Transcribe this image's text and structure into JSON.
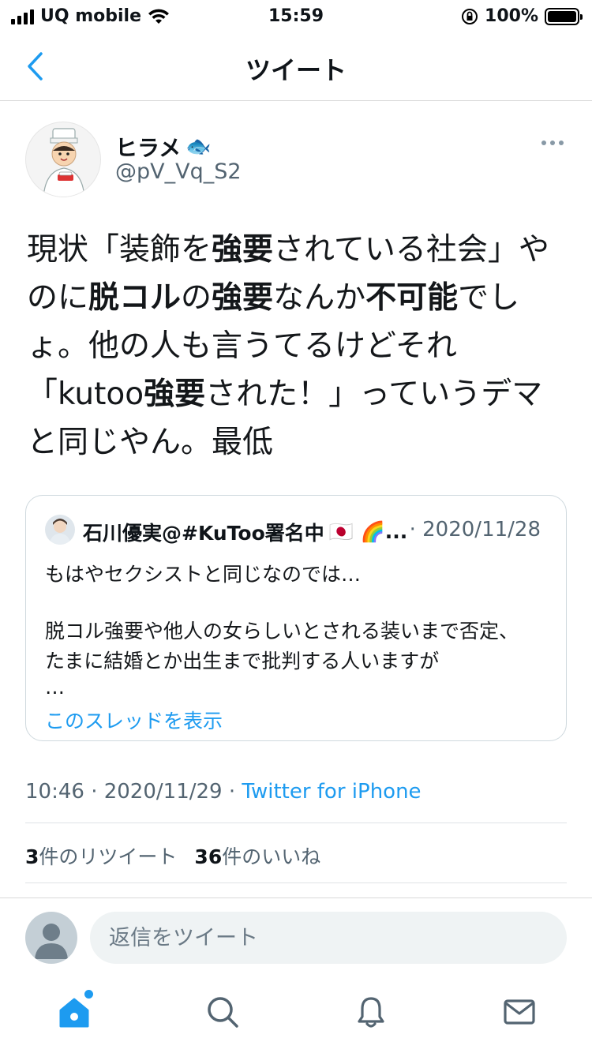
{
  "status_bar": {
    "carrier": "UQ mobile",
    "time": "15:59",
    "battery": "100%"
  },
  "nav": {
    "title": "ツイート"
  },
  "tweet": {
    "display_name": "ヒラメ",
    "name_emoji": "🐟",
    "handle": "@pV_Vq_S2",
    "timestamp": "10:46 · 2020/11/29 · ",
    "source": "Twitter for iPhone"
  },
  "quote": {
    "author": "石川優実@#KuToo署名中",
    "author_suffix": "🇯🇵 🌈...",
    "date": "· 2020/11/28",
    "lines": [
      "もはやセクシストと同じなのでは…",
      "脱コル強要や他人の女らしいとされる装いまで否定、",
      "たまに結婚とか出生まで批判する人いますが",
      "…"
    ],
    "show_thread": "このスレッドを表示"
  },
  "stats": {
    "retweet_count": "3",
    "retweet_label": "件のリツイート",
    "like_count": "36",
    "like_label": "件のいいね"
  },
  "reply": {
    "placeholder": "返信をツイート"
  },
  "tabs": [
    "home-icon",
    "search-icon",
    "notifications-icon",
    "messages-icon"
  ],
  "colors": {
    "accent": "#1d9bf0",
    "secondary_text": "#536471"
  }
}
